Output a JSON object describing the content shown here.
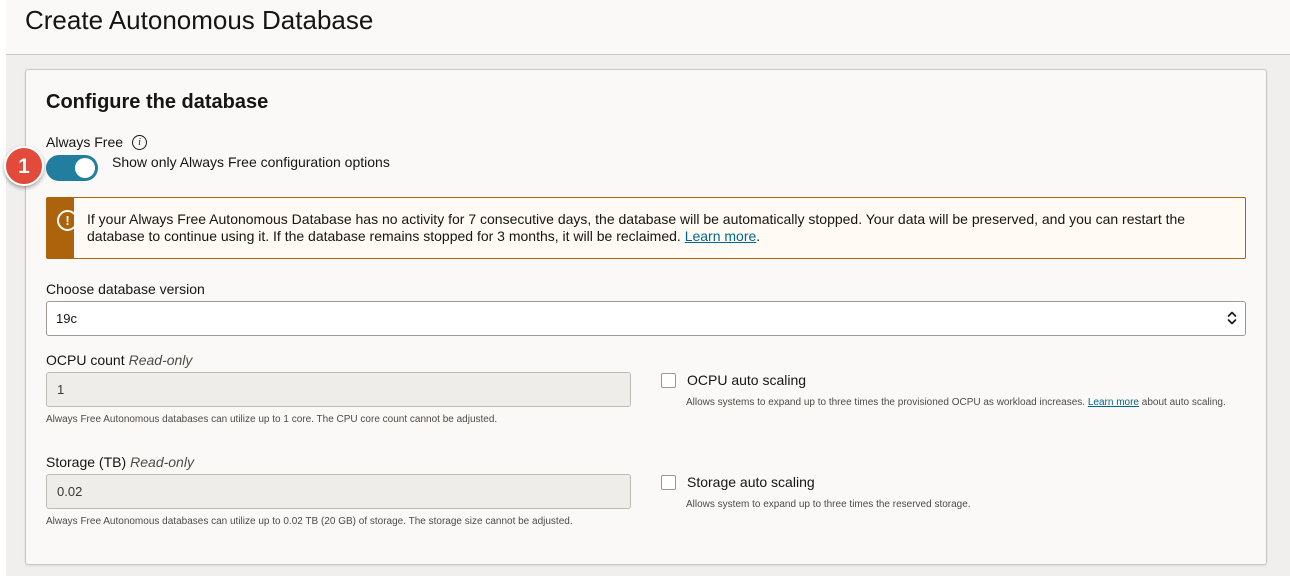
{
  "page": {
    "title": "Create Autonomous Database"
  },
  "section": {
    "title": "Configure the database"
  },
  "always_free": {
    "label": "Always Free",
    "info_icon": "i",
    "toggle_on": true,
    "toggle_text": "Show only Always Free configuration options"
  },
  "marker": {
    "number": "1"
  },
  "warning": {
    "icon": "!",
    "text": "If your Always Free Autonomous Database has no activity for 7 consecutive days, the database will be automatically stopped. Your data will be preserved, and you can restart the database to continue using it. If the database remains stopped for 3 months, it will be reclaimed. ",
    "link": "Learn more",
    "period": "."
  },
  "version": {
    "label": "Choose database version",
    "value": "19c"
  },
  "ocpu": {
    "label": "OCPU count",
    "readonly": "Read-only",
    "value": "1",
    "help": "Always Free Autonomous databases can utilize up to 1 core. The CPU core count cannot be adjusted.",
    "autoscale_label": "OCPU auto scaling",
    "autoscale_checked": false,
    "autoscale_help_pre": "Allows systems to expand up to three times the provisioned OCPU as workload increases. ",
    "autoscale_help_link": "Learn more",
    "autoscale_help_post": " about auto scaling."
  },
  "storage": {
    "label": "Storage (TB)",
    "readonly": "Read-only",
    "value": "0.02",
    "help": "Always Free Autonomous databases can utilize up to 0.02 TB (20 GB) of storage. The storage size cannot be adjusted.",
    "autoscale_label": "Storage auto scaling",
    "autoscale_checked": false,
    "autoscale_help": "Allows system to expand up to three times the reserved storage."
  }
}
